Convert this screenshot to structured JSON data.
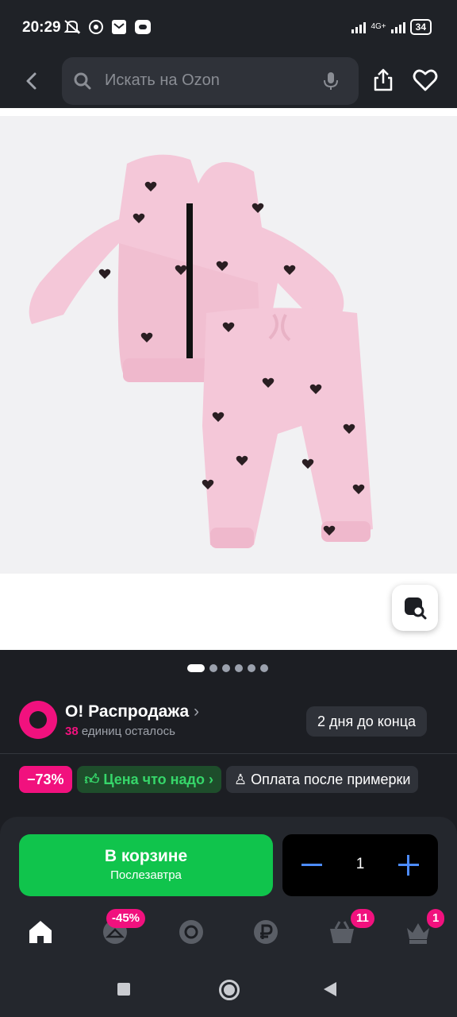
{
  "status_bar": {
    "time": "20:29",
    "network": "4G+",
    "battery": "34"
  },
  "header": {
    "search_placeholder": "Искать на Ozon"
  },
  "gallery": {
    "total_images": 6,
    "active_index": 0
  },
  "promo": {
    "title": "О! Распродажа",
    "remaining_count": "38",
    "remaining_text": "единиц осталось",
    "deadline": "2 дня до конца"
  },
  "badges": {
    "discount": "−73%",
    "price_label": "Цена что надо",
    "payment_label": "Оплата после примерки"
  },
  "cart": {
    "title": "В корзине",
    "delivery": "Послезавтра",
    "quantity": "1"
  },
  "bottom_nav": {
    "items": [
      {
        "name": "home",
        "badge": ""
      },
      {
        "name": "fashion",
        "badge": "-45%"
      },
      {
        "name": "fresh",
        "badge": ""
      },
      {
        "name": "finance",
        "badge": ""
      },
      {
        "name": "cart",
        "badge": "11"
      },
      {
        "name": "profile",
        "badge": "1"
      }
    ]
  },
  "colors": {
    "accent_pink": "#f1117e",
    "green": "#10c44c",
    "blue": "#4d8cff",
    "background": "#1c1e23"
  }
}
